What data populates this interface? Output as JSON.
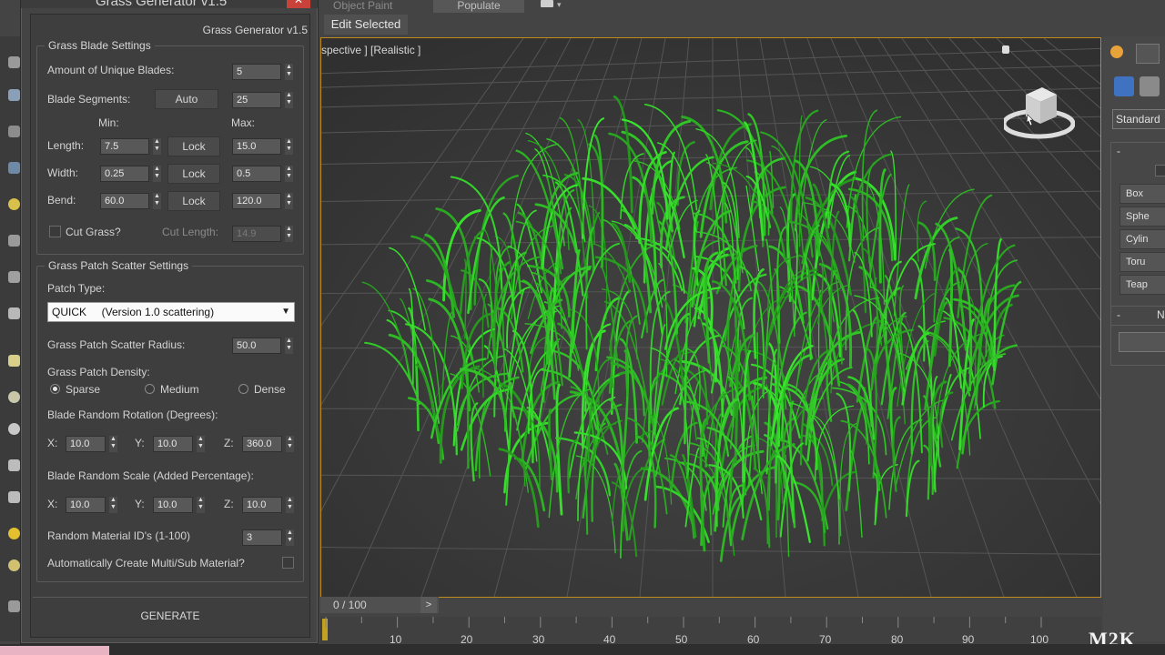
{
  "ribbon": {
    "tab_object_paint": "Object Paint",
    "tab_populate": "Populate",
    "edit_selected": "Edit Selected"
  },
  "viewport": {
    "label": "spective ] [Realistic ]"
  },
  "command_panel": {
    "dropdown_value": "Standard",
    "dash_label": "-",
    "dash_label_2": "-",
    "n_label": "N",
    "buttons": [
      "Box",
      "Sphe",
      "Cylin",
      "Toru",
      "Teap"
    ]
  },
  "timeline": {
    "frame_counter": "0 / 100",
    "next_glyph": ">",
    "ticks": [
      "10",
      "20",
      "30",
      "40",
      "50",
      "60",
      "70",
      "80",
      "90",
      "100"
    ]
  },
  "watermark": "M2K",
  "dialog": {
    "title": "Grass Generator v1.5",
    "header_label": "Grass Generator v1.5",
    "close_glyph": "✕",
    "blade_settings": {
      "title": "Grass Blade Settings",
      "unique_blades_label": "Amount of Unique Blades:",
      "unique_blades_value": "5",
      "segments_label": "Blade Segments:",
      "auto_button": "Auto",
      "segments_value": "25",
      "min_label": "Min:",
      "max_label": "Max:",
      "length_label": "Length:",
      "length_min": "7.5",
      "length_max": "15.0",
      "width_label": "Width:",
      "width_min": "0.25",
      "width_max": "0.5",
      "bend_label": "Bend:",
      "bend_min": "60.0",
      "bend_max": "120.0",
      "lock_label": "Lock",
      "cut_grass_label": "Cut Grass?",
      "cut_length_label": "Cut Length:",
      "cut_length_value": "14.9"
    },
    "scatter_settings": {
      "title": "Grass Patch Scatter Settings",
      "patch_type_label": "Patch Type:",
      "patch_type_value": "QUICK     (Version 1.0 scattering)",
      "scatter_radius_label": "Grass Patch Scatter Radius:",
      "scatter_radius_value": "50.0",
      "density_label": "Grass Patch Density:",
      "density_options": [
        "Sparse",
        "Medium",
        "Dense"
      ],
      "density_selected": "Sparse",
      "rotation_label": "Blade Random Rotation (Degrees):",
      "rot_x_label": "X:",
      "rot_x": "10.0",
      "rot_y_label": "Y:",
      "rot_y": "10.0",
      "rot_z_label": "Z:",
      "rot_z": "360.0",
      "scale_label": "Blade Random Scale (Added Percentage):",
      "scale_x_label": "X:",
      "scale_x": "10.0",
      "scale_y_label": "Y:",
      "scale_y": "10.0",
      "scale_z_label": "Z:",
      "scale_z": "10.0",
      "material_ids_label": "Random Material ID's (1-100)",
      "material_ids_value": "3",
      "multisub_label": "Automatically Create Multi/Sub Material?"
    },
    "generate_button": "GENERATE"
  }
}
